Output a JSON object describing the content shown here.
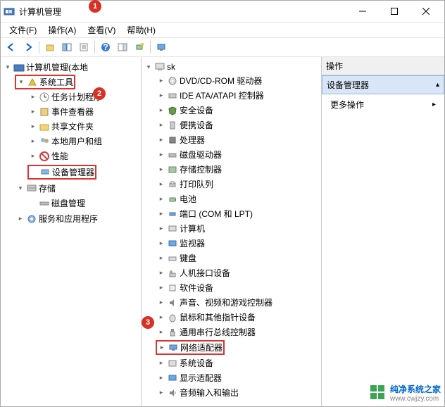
{
  "window": {
    "title": "计算机管理"
  },
  "menu": {
    "file": "文件(F)",
    "action": "操作(A)",
    "view": "查看(V)",
    "help": "帮助(H)"
  },
  "leftTree": {
    "root": "计算机管理(本地",
    "systemTools": "系统工具",
    "taskScheduler": "任务计划程序",
    "eventViewer": "事件查看器",
    "sharedFolders": "共享文件夹",
    "localUsers": "本地用户和组",
    "performance": "性能",
    "deviceManager": "设备管理器",
    "storage": "存储",
    "diskMgmt": "磁盘管理",
    "services": "服务和应用程序"
  },
  "midTree": {
    "root": "sk",
    "dvd": "DVD/CD-ROM 驱动器",
    "ide": "IDE ATA/ATAPI 控制器",
    "security": "安全设备",
    "portable": "便携设备",
    "cpu": "处理器",
    "diskDrives": "磁盘驱动器",
    "storageCtrl": "存储控制器",
    "printQueue": "打印队列",
    "battery": "电池",
    "ports": "端口 (COM 和 LPT)",
    "computer": "计算机",
    "monitor": "监视器",
    "keyboard": "键盘",
    "hid": "人机接口设备",
    "softDev": "软件设备",
    "sound": "声音、视频和游戏控制器",
    "mouse": "鼠标和其他指针设备",
    "usb": "通用串行总线控制器",
    "network": "网络适配器",
    "system": "系统设备",
    "display": "显示适配器",
    "audio": "音频输入和输出"
  },
  "rightPane": {
    "header": "操作",
    "section": "设备管理器",
    "more": "更多操作"
  },
  "badges": {
    "b1": "1",
    "b2": "2",
    "b3": "3"
  },
  "watermark": {
    "name": "纯净系统之家",
    "url": "www.cwjzy.com"
  }
}
